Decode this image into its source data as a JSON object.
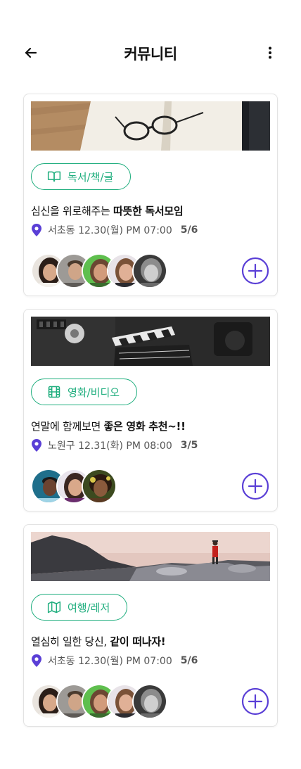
{
  "header": {
    "title": "커뮤니티",
    "back_icon": "arrow-left-icon",
    "more_icon": "more-vertical-icon"
  },
  "colors": {
    "accent_green": "#1fae7e",
    "accent_purple": "#5a3fd6"
  },
  "cards": [
    {
      "category": "독서/책/글",
      "category_icon": "book-open-icon",
      "title_plain": "심신을 위로해주는 ",
      "title_bold": "따뜻한 독서모임",
      "location": "서초동",
      "datetime": "12.30(월) PM 07:00",
      "count": "5/6",
      "join_icon": "plus-circle-icon"
    },
    {
      "category": "영화/비디오",
      "category_icon": "film-icon",
      "title_plain": "연말에 함께보면 ",
      "title_bold": "좋은 영화 추천~!!",
      "location": "노원구",
      "datetime": "12.31(화) PM 08:00",
      "count": "3/5",
      "join_icon": "plus-circle-icon"
    },
    {
      "category": "여행/레저",
      "category_icon": "map-icon",
      "title_plain": "열심히 일한 당신, ",
      "title_bold": "같이 떠나자!",
      "location": "서초동",
      "datetime": "12.30(월) PM 07:00",
      "count": "5/6",
      "join_icon": "plus-circle-icon"
    }
  ]
}
